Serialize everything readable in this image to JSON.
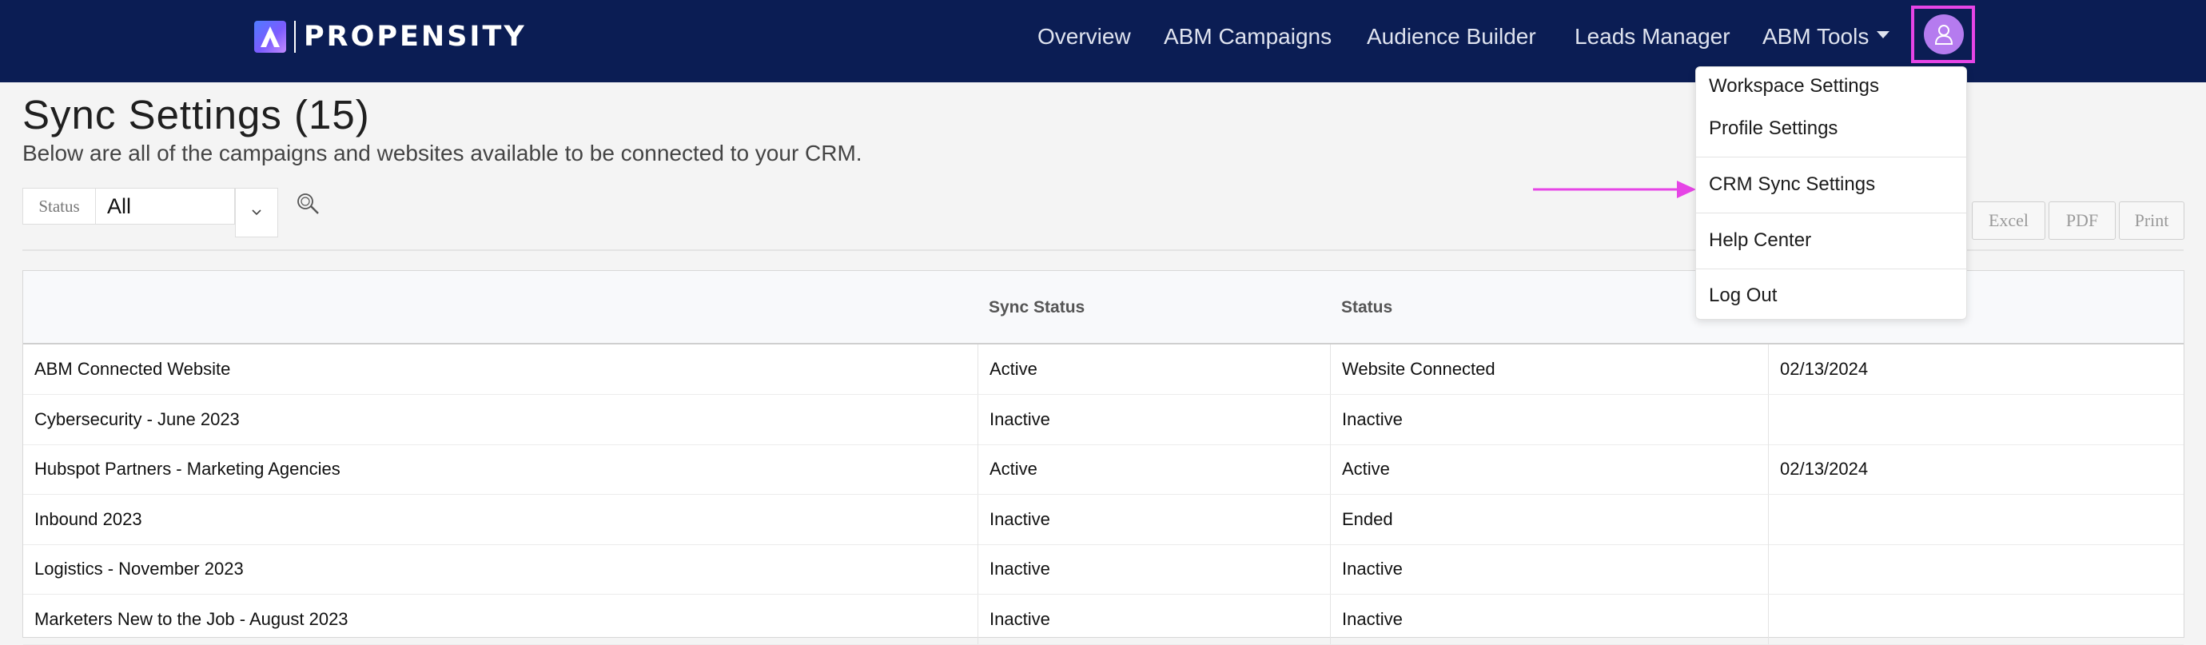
{
  "brand": {
    "name": "PROPENSITY"
  },
  "nav": {
    "items": [
      "Overview",
      "ABM Campaigns",
      "Audience Builder",
      "Leads Manager"
    ],
    "tools_label": "ABM Tools"
  },
  "page": {
    "title": "Sync Settings (15)",
    "subtitle": "Below are all of the campaigns and websites available to be connected to your CRM."
  },
  "filter": {
    "label": "Status",
    "value": "All"
  },
  "export_buttons": [
    "Excel",
    "PDF",
    "Print"
  ],
  "table": {
    "headers": [
      "",
      "Sync Status",
      "Status"
    ],
    "rows": [
      [
        "ABM Connected Website",
        "Active",
        "Website Connected",
        "02/13/2024"
      ],
      [
        "Cybersecurity - June 2023",
        "Inactive",
        "Inactive",
        ""
      ],
      [
        "Hubspot Partners - Marketing Agencies",
        "Active",
        "Active",
        "02/13/2024"
      ],
      [
        "Inbound 2023",
        "Inactive",
        "Ended",
        ""
      ],
      [
        "Logistics - November 2023",
        "Inactive",
        "Inactive",
        ""
      ],
      [
        "Marketers New to the Job - August 2023",
        "Inactive",
        "Inactive",
        ""
      ]
    ]
  },
  "user_menu": {
    "items": [
      "Workspace Settings",
      "Profile Settings",
      "CRM Sync Settings",
      "Help Center",
      "Log Out"
    ]
  },
  "colors": {
    "nav_bg": "#0b1d54",
    "highlight": "#e645e6",
    "avatar": "#b57bef"
  },
  "icons": [
    "propensity-logo-icon",
    "caret-down-icon",
    "user-icon",
    "chevron-down-icon",
    "search-icon",
    "arrow-right-icon"
  ]
}
